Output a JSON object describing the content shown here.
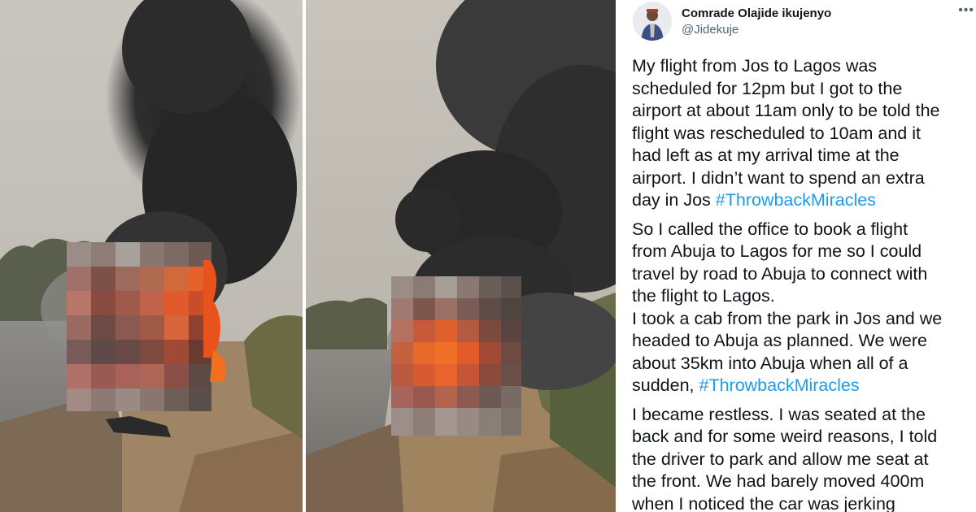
{
  "tweet": {
    "author_name": "Comrade Olajide ikujenyo",
    "author_handle": "@Jidekuje",
    "more_icon": "more-horizontal-icon",
    "link_color": "#1d9bf0",
    "paragraphs": [
      {
        "lines": [
          "My flight from Jos to Lagos was",
          "scheduled for 12pm but I got to the",
          "airport at about 11am only to be told the",
          "flight was rescheduled to 10am and it",
          "had left as at my arrival time at the",
          "airport. I didn’t want to spend an extra",
          "day in Jos "
        ],
        "hashtag": "#ThrowbackMiracles"
      },
      {
        "lines": [
          "So I called the office to book a flight",
          "from Abuja to Lagos for me so I could",
          "travel by road to Abuja to connect with",
          "the flight to Lagos.",
          "I took a cab from the park in Jos and we",
          "headed to Abuja as planned. We were",
          "about 35km into Abuja when all of a",
          "sudden, "
        ],
        "hashtag": "#ThrowbackMiracles"
      },
      {
        "lines": [
          "I became restless. I was seated at the",
          "back and for some weird reasons, I told",
          "the driver to park and allow me seat at",
          "the front. We had barely moved 400m",
          "when I noticed the car was jerking"
        ],
        "hashtag": ""
      }
    ]
  }
}
